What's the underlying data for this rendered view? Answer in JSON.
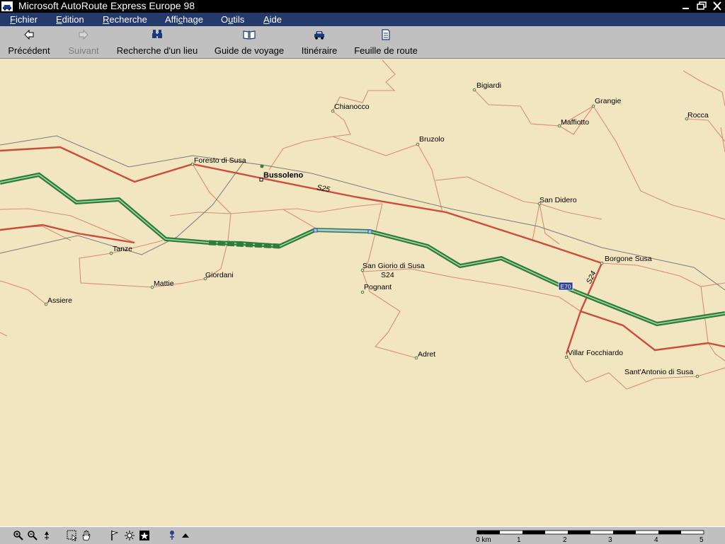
{
  "window": {
    "title": "Microsoft AutoRoute Express Europe 98"
  },
  "menubar": {
    "items": [
      {
        "label": "Fichier",
        "key": "F",
        "rest": "ichier"
      },
      {
        "label": "Edition",
        "key": "E",
        "rest": "dition"
      },
      {
        "label": "Recherche",
        "key": "R",
        "rest": "echerche"
      },
      {
        "label": "Affichage",
        "pre": "Affi",
        "key": "c",
        "rest": "hage"
      },
      {
        "label": "Outils",
        "pre": "O",
        "key": "u",
        "rest": "tils"
      },
      {
        "label": "Aide",
        "key": "A",
        "rest": "ide"
      }
    ]
  },
  "toolbar": {
    "previous": "Précédent",
    "next": "Suivant",
    "find_place": "Recherche d'un lieu",
    "travel_guide": "Guide de voyage",
    "route": "Itinéraire",
    "route_sheet": "Feuille de route"
  },
  "map": {
    "places": {
      "bigiardi": "Bigiardi",
      "chianocco": "Chianocco",
      "grangie": "Grangie",
      "maffiotto": "Maffiotto",
      "rocca": "Rocca",
      "bruzolo": "Bruzolo",
      "foresto": "Foresto di Susa",
      "bussoleno": "Bussoleno",
      "san_didero": "San Didero",
      "tanze": "Tanze",
      "giordani": "Giordani",
      "mattie": "Mattie",
      "assiere": "Assiere",
      "san_giorio": "San Giorio di Susa",
      "pognant": "Pognant",
      "borgone": "Borgone Susa",
      "villar": "Villar Focchiardo",
      "sant_antonio": "Sant'Antonio di Susa",
      "adret": "Adret"
    },
    "roads": {
      "s25": "S25",
      "s24a": "S24",
      "s24b": "S24",
      "e70": "E70"
    },
    "colors": {
      "background": "#f2e6c1",
      "minor_road": "#d98c76",
      "main_road": "#cc4b3c",
      "route": "#2e7d3a",
      "railway": "#7a7a7a"
    }
  },
  "scale": {
    "unit": "0 km",
    "ticks": [
      "1",
      "2",
      "3",
      "4",
      "5"
    ]
  }
}
